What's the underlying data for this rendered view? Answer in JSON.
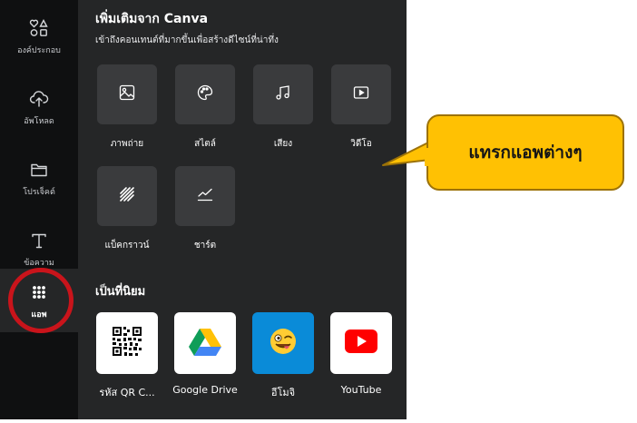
{
  "sidebar": {
    "items": [
      {
        "label": "องค์ประกอบ",
        "icon": "elements-icon"
      },
      {
        "label": "อัพโหลด",
        "icon": "upload-cloud-icon"
      },
      {
        "label": "โปรเจ็คต์",
        "icon": "folder-icon"
      },
      {
        "label": "ข้อความ",
        "icon": "text-icon"
      },
      {
        "label": "แอพ",
        "icon": "apps-grid-icon"
      }
    ]
  },
  "panel": {
    "title": "เพิ่มเติมจาก Canva",
    "subtitle": "เข้าถึงคอนเทนต์ที่มากขึ้นเพื่อสร้างดีไซน์ที่น่าทึ่ง",
    "categories": [
      {
        "label": "ภาพถ่าย",
        "icon": "image-icon"
      },
      {
        "label": "สไตล์",
        "icon": "palette-icon"
      },
      {
        "label": "เสียง",
        "icon": "music-note-icon"
      },
      {
        "label": "วิดีโอ",
        "icon": "video-icon"
      },
      {
        "label": "แบ็คกราวน์",
        "icon": "background-pattern-icon"
      },
      {
        "label": "ชาร์ต",
        "icon": "chart-line-icon"
      }
    ],
    "popular_title": "เป็นที่นิยม",
    "apps": [
      {
        "label": "รหัส QR C...",
        "icon": "qr-code-icon"
      },
      {
        "label": "Google Drive",
        "icon": "google-drive-icon"
      },
      {
        "label": "อีโมจิ",
        "icon": "emoji-icon"
      },
      {
        "label": "YouTube",
        "icon": "youtube-icon"
      }
    ]
  },
  "callout": {
    "text": "แทรกแอพต่างๆ"
  },
  "colors": {
    "sidebar_bg": "#0f1011",
    "panel_bg": "#252627",
    "tile_bg": "#3a3b3d",
    "highlight_ring": "#c9141b",
    "callout_bg": "#ffc103"
  }
}
